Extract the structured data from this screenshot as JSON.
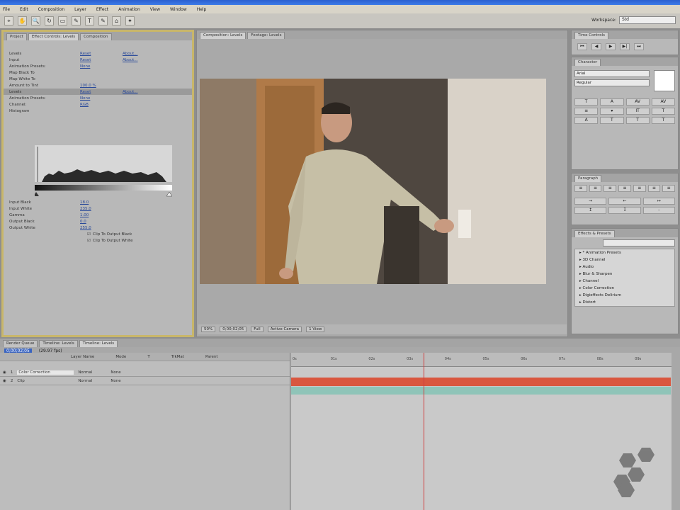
{
  "menubar": [
    "File",
    "Edit",
    "Composition",
    "Layer",
    "Effect",
    "Animation",
    "View",
    "Window",
    "Help"
  ],
  "toolbar": {
    "tools": [
      "⌖",
      "✋",
      "🔍",
      "↻",
      "▭",
      "✎",
      "T",
      "✎",
      "⌂",
      "✦"
    ],
    "workspace_label": "Workspace:",
    "workspace_value": "Std"
  },
  "effect_panel": {
    "tabs": [
      "Project",
      "Effect Controls: Levels",
      "Composition"
    ],
    "rows": [
      {
        "label": "Levels",
        "v1": "Reset",
        "v2": "About..."
      },
      {
        "label": "Input",
        "v1": "Reset",
        "v2": "About..."
      },
      {
        "label": "Animation Presets:",
        "v1": "None",
        "v2": ""
      },
      {
        "label": "Map Black To",
        "v1": "",
        "v2": ""
      },
      {
        "label": "Map White To",
        "v1": "",
        "v2": ""
      },
      {
        "label": "Amount to Tint",
        "v1": "100.0 %",
        "v2": ""
      },
      {
        "label": "Levels",
        "v1": "Reset",
        "v2": "About..."
      },
      {
        "label": "Animation Presets:",
        "v1": "None",
        "v2": ""
      },
      {
        "label": "Channel:",
        "v1": "RGB",
        "v2": ""
      },
      {
        "label": "Histogram",
        "v1": "",
        "v2": ""
      }
    ],
    "params": [
      {
        "label": "Input Black",
        "value": "18.0"
      },
      {
        "label": "Input White",
        "value": "235.0"
      },
      {
        "label": "Gamma",
        "value": "1.00"
      },
      {
        "label": "Output Black",
        "value": "0.0"
      },
      {
        "label": "Output White",
        "value": "255.0"
      }
    ],
    "checks": [
      "Clip To Output Black",
      "Clip To Output White"
    ]
  },
  "comp_panel": {
    "tabs": [
      "Composition: Levels",
      "Footage: Levels"
    ],
    "controls": [
      "50%",
      "0;00;02;05",
      "Full",
      "Active Camera",
      "1 View"
    ]
  },
  "right_panels": {
    "time_controls_tab": "Time Controls",
    "character_tab": "Character",
    "font": "Arial",
    "font_style": "Regular",
    "paragraph_tab": "Paragraph",
    "effects_tab": "Effects & Presets",
    "effects_list": [
      "* Animation Presets",
      "3D Channel",
      "Audio",
      "Blur & Sharpen",
      "Channel",
      "Color Correction",
      "Digieffects Delirium",
      "Distort"
    ]
  },
  "timeline": {
    "tabs": [
      "Render Queue",
      "Timeline: Levels",
      "Timeline: Levels"
    ],
    "timecode": "0;00;02;05",
    "fps": "(29.97 fps)",
    "columns": [
      "Layer Name",
      "Mode",
      "T",
      "TrkMat",
      "Parent"
    ],
    "layers": [
      {
        "num": "1",
        "name": "Color Correction",
        "mode": "Normal",
        "parent": "None"
      },
      {
        "num": "2",
        "name": "Clip",
        "mode": "Normal",
        "parent": "None"
      }
    ],
    "ruler": [
      "0s",
      "01s",
      "02s",
      "03s",
      "04s",
      "05s",
      "06s",
      "07s",
      "08s",
      "09s"
    ]
  }
}
